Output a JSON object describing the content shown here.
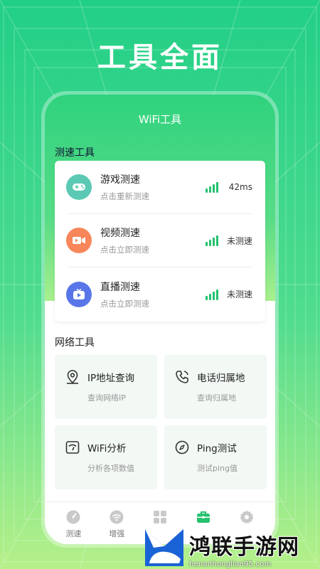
{
  "headline": "工具全面",
  "app": {
    "title": "WiFi工具"
  },
  "speed_section": {
    "label": "测速工具",
    "items": [
      {
        "name": "游戏测速",
        "sub": "点击重新测速",
        "value": "42ms",
        "icon": "gamepad-icon",
        "color": "#5bc9b3"
      },
      {
        "name": "视频测速",
        "sub": "点击立即测速",
        "value": "未测速",
        "icon": "video-icon",
        "color": "#f7865a"
      },
      {
        "name": "直播测速",
        "sub": "点击立即测速",
        "value": "未测速",
        "icon": "live-play-icon",
        "color": "#5876e8"
      }
    ]
  },
  "network_section": {
    "label": "网络工具",
    "items": [
      {
        "title": "IP地址查询",
        "sub": "查询网络IP",
        "icon": "location-pin-icon"
      },
      {
        "title": "电话归属地",
        "sub": "查询归属地",
        "icon": "phone-icon"
      },
      {
        "title": "WiFi分析",
        "sub": "分析各项数值",
        "icon": "wifi-analysis-icon"
      },
      {
        "title": "Ping测试",
        "sub": "测试ping值",
        "icon": "ping-compass-icon"
      }
    ]
  },
  "tabbar": {
    "items": [
      {
        "label": "测速",
        "icon": "speedometer-icon",
        "active": false
      },
      {
        "label": "增强",
        "icon": "wifi-boost-icon",
        "active": false
      },
      {
        "label": "",
        "icon": "apps-icon",
        "active": false
      },
      {
        "label": "",
        "icon": "toolbox-icon",
        "active": true
      },
      {
        "label": "",
        "icon": "settings-icon",
        "active": false
      }
    ]
  },
  "watermark": {
    "name": "鸿联手游网",
    "url": "henanhonglian95.com"
  },
  "colors": {
    "accent": "#25c16f",
    "green_top": "#22cf86",
    "green_bottom": "#b6f08a"
  }
}
